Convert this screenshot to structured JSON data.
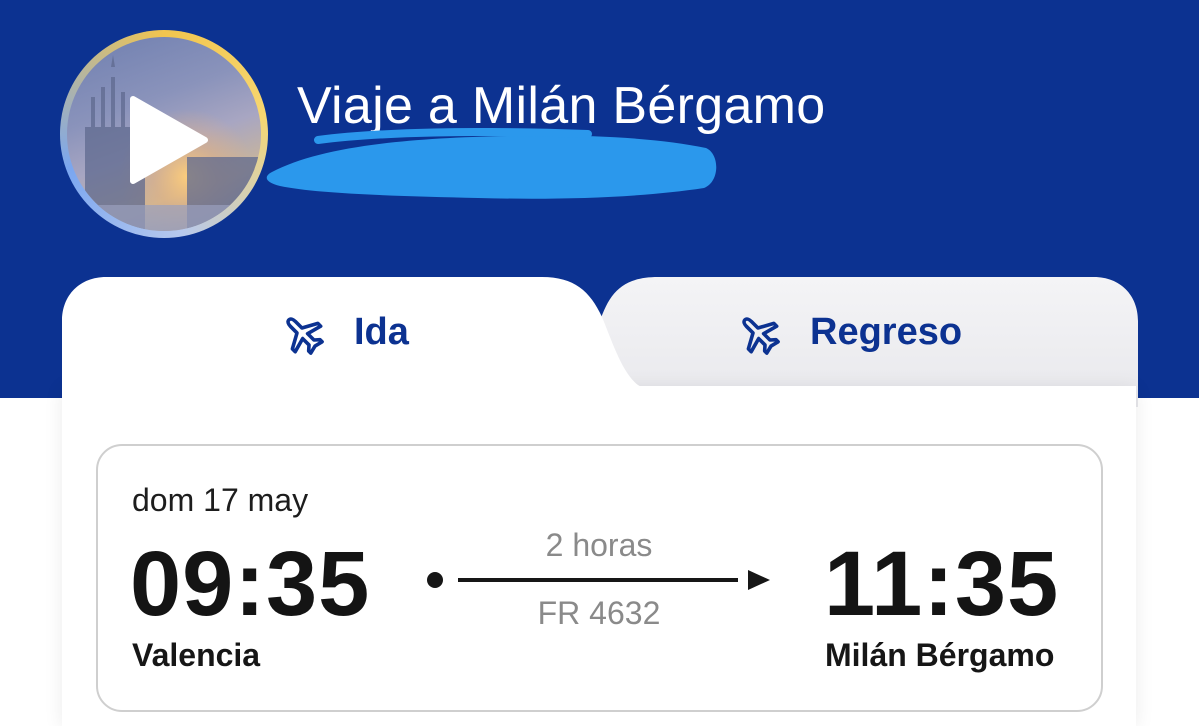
{
  "header": {
    "trip_title": "Viaje a Milán Bérgamo",
    "background_color": "#0c3291",
    "avatar_icon": "play-icon"
  },
  "tabs": [
    {
      "label": "Ida",
      "icon": "plane-icon",
      "active": true
    },
    {
      "label": "Regreso",
      "icon": "plane-icon",
      "active": false
    }
  ],
  "flight": {
    "date": "dom 17 may",
    "departure_time": "09:35",
    "arrival_time": "11:35",
    "departure_city": "Valencia",
    "arrival_city": "Milán Bérgamo",
    "duration": "2 horas",
    "flight_number": "FR 4632"
  },
  "colors": {
    "brand_blue": "#0c3291",
    "redaction_blue": "#2b98ec",
    "muted_text": "#8a8a8a"
  }
}
